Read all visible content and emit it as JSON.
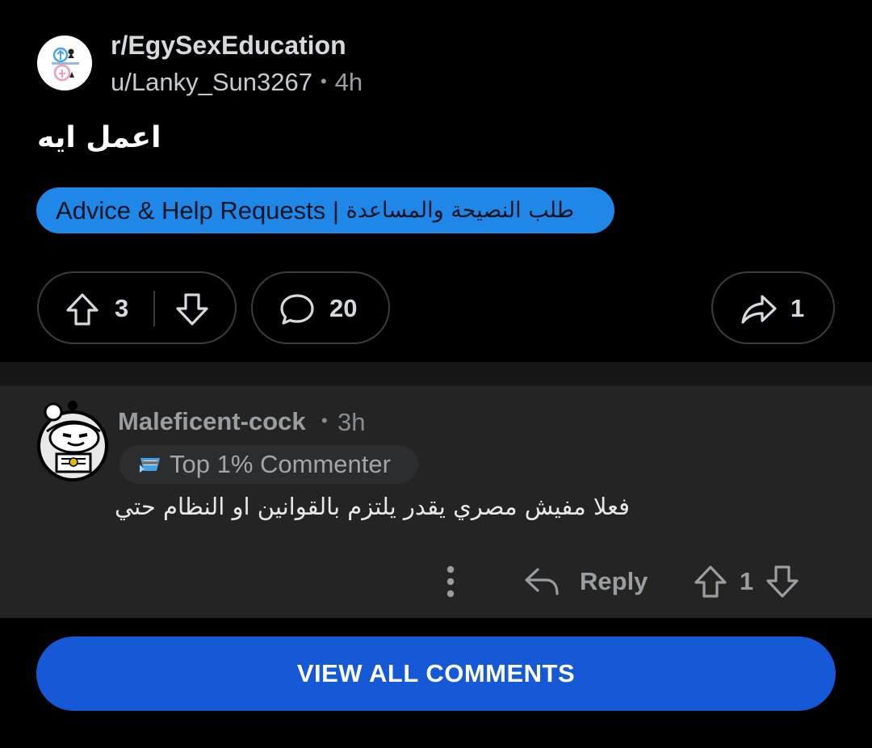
{
  "post": {
    "subreddit": "r/EgySexEducation",
    "author": "u/Lanky_Sun3267",
    "separator": "•",
    "age": "4h",
    "title": "اعمل ايه",
    "flair_en": "Advice & Help Requests |",
    "flair_ar": "طلب النصيحة والمساعدة",
    "upvotes": "3",
    "comments": "20",
    "shares": "1"
  },
  "comment": {
    "author": "Maleficent-cock",
    "separator": "•",
    "age": "3h",
    "badge": "Top 1% Commenter",
    "body": "فعلا مفيش مصري يقدر يلتزم بالقوانين او النظام حتي",
    "reply_label": "Reply",
    "score": "1"
  },
  "view_all_label": "VIEW ALL COMMENTS",
  "colors": {
    "background": "#000000",
    "comment_bg": "#242425",
    "flair": "#1f87e8",
    "primary_button": "#1559d6"
  }
}
